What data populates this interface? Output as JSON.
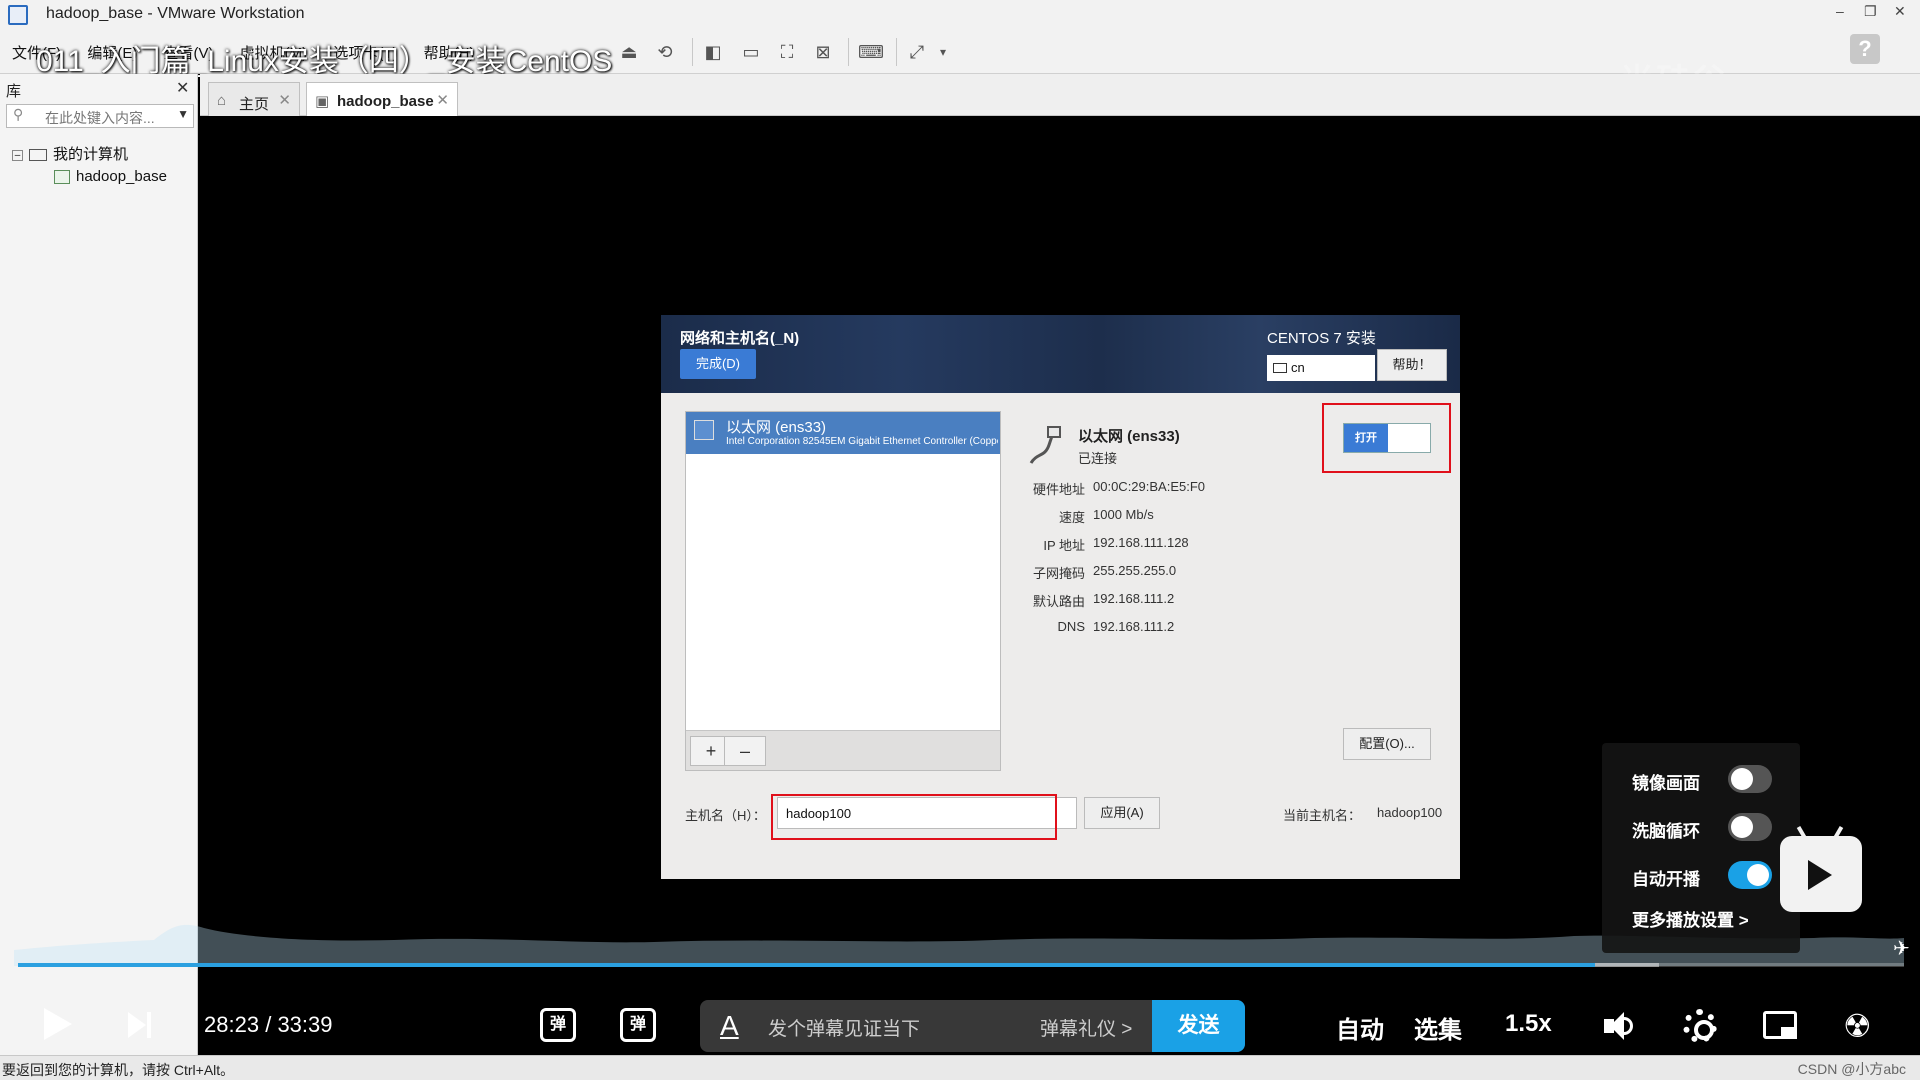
{
  "window": {
    "title": "hadoop_base - VMware Workstation"
  },
  "menubar": {
    "items": [
      "文件(F)",
      "编辑(E)",
      "查看(V)",
      "虚拟机(M)",
      "选项卡(T)",
      "帮助(H)"
    ]
  },
  "video": {
    "overlay_title": "011_入门篇_Linux安装（四）_安装CentOS",
    "current_time": "28:23",
    "separator": "/",
    "total_time": "33:39",
    "progress_fraction": 0.836,
    "buffered_fraction": 0.87,
    "danmaku_input_placeholder": "发个弹幕见证当下",
    "danmaku_etiquette": "弹幕礼仪 >",
    "send_label": "发送",
    "auto_label": "自动",
    "episodes_label": "选集",
    "speed_label": "1.5x",
    "danmaku_icon_glyph": "弹"
  },
  "settings_popup": {
    "mirror_label": "镜像画面",
    "mirror_on": false,
    "loop_label": "洗脑循环",
    "loop_on": false,
    "autoplay_label": "自动开播",
    "autoplay_on": true,
    "more_label": "更多播放设置  >"
  },
  "library": {
    "header": "库",
    "search_placeholder": "在此处键入内容...",
    "tree_root": "我的计算机",
    "tree_child": "hadoop_base"
  },
  "tabs": [
    {
      "label": "主页"
    },
    {
      "label": "hadoop_base"
    }
  ],
  "installer": {
    "title": "网络和主机名(_N)",
    "done_button": "完成(D)",
    "product": "CENTOS 7 安装",
    "keyboard_layout": "cn",
    "help_button": "帮助！",
    "interface_name": "以太网 (ens33)",
    "interface_desc": "Intel Corporation 82545EM Gigabit Ethernet Controller (Copper)",
    "add_button": "+",
    "remove_button": "–",
    "detail_name": "以太网 (ens33)",
    "detail_status": "已连接",
    "switch_label": "打开",
    "switch_on": true,
    "properties": [
      {
        "key": "硬件地址",
        "value": "00:0C:29:BA:E5:F0"
      },
      {
        "key": "速度",
        "value": "1000 Mb/s"
      },
      {
        "key": "IP 地址",
        "value": "192.168.111.128"
      },
      {
        "key": "子网掩码",
        "value": "255.255.255.0"
      },
      {
        "key": "默认路由",
        "value": "192.168.111.2"
      },
      {
        "key": "DNS",
        "value": "192.168.111.2"
      }
    ],
    "configure_button": "配置(O)...",
    "hostname_label": "主机名（H）：",
    "hostname_value": "hadoop100",
    "apply_button": "应用(A)",
    "current_hostname_label": "当前主机名：",
    "current_hostname_value": "hadoop100"
  },
  "statusbar": {
    "text": "要返回到您的计算机，请按 Ctrl+Alt。",
    "credit": "CSDN @小方abc"
  },
  "colors": {
    "accent_blue": "#1aa1e6",
    "installer_blue": "#3a7bd5",
    "highlight_red": "#e0101b"
  }
}
